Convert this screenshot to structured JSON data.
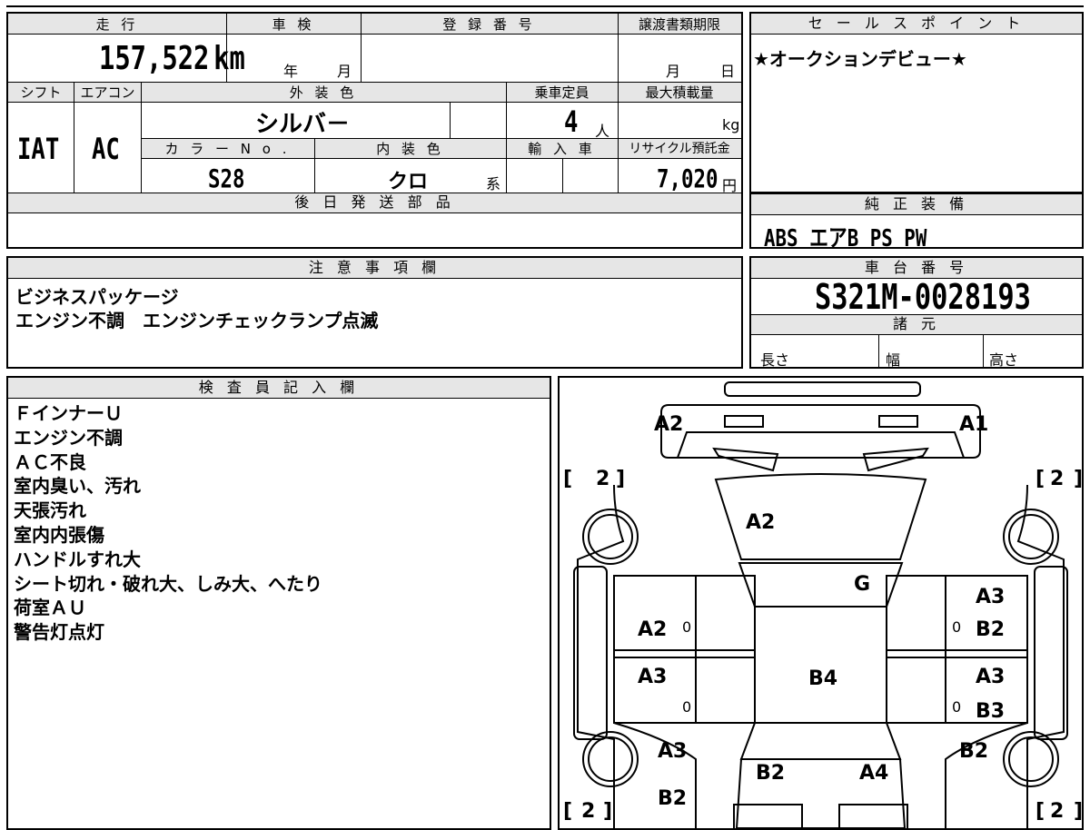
{
  "spec": {
    "headers": {
      "mileage": "走 行",
      "inspection": "車 検",
      "registration": "登 録 番 号",
      "transfer_deadline": "譲渡書類期限",
      "shift": "シフト",
      "aircon": "エアコン",
      "exterior_color": "外 装 色",
      "capacity": "乗車定員",
      "max_load": "最大積載量",
      "color_no": "カ ラ ー N o .",
      "interior_color": "内 装 色",
      "import": "輸 入 車",
      "recycle": "リサイクル預託金",
      "later_parts": "後 日 発 送 部 品"
    },
    "mileage_value": "157,522",
    "mileage_unit": "km",
    "year_label": "年",
    "month_label": "月",
    "day_label": "日",
    "shift_value": "IAT",
    "aircon_value": "AC",
    "exterior_color_value": "シルバ－",
    "capacity_value": "4",
    "capacity_unit": "人",
    "max_load_unit": "kg",
    "color_no_value": "S28",
    "interior_color_value": "クロ",
    "interior_suffix": "系",
    "recycle_value": "7,020",
    "recycle_unit": "円"
  },
  "sales_points": {
    "header": "セ ー ル ス ポ イ ン ト",
    "text": "★オークションデビュー★"
  },
  "equipment": {
    "header": "純 正 装 備",
    "text": "ABS エアB PS PW"
  },
  "notes": {
    "header": "注 意 事 項 欄",
    "lines": [
      "ビジネスパッケージ",
      "エンジン不調　エンジンチェックランプ点滅"
    ]
  },
  "chassis": {
    "header": "車 台 番 号",
    "value": "S321M-0028193",
    "specs_header": "諸 元",
    "length_label": "長さ",
    "width_label": "幅",
    "height_label": "高さ"
  },
  "inspector": {
    "header": "検 査 員 記 入 欄",
    "lines": [
      "ＦインナーＵ",
      "エンジン不調",
      "ＡＣ不良",
      "室内臭い、汚れ",
      "天張汚れ",
      "室内内張傷",
      "ハンドルすれ大",
      "シート切れ・破れ大、しみ大、へたり",
      "荷室ＡＵ",
      "警告灯点灯"
    ]
  },
  "diagram": {
    "marks": {
      "front_left": "A2",
      "front_right": "A1",
      "hood": "A2",
      "windshield": "G",
      "left_front_door": "A2",
      "right_front_door_1": "A3",
      "right_front_door_2": "B2",
      "left_rear_door": "A3",
      "right_rear_door_1": "A3",
      "right_rear_door_2": "B3",
      "roof": "B4",
      "left_quarter": "A3",
      "right_quarter": "B2",
      "rear_left_bumper": "B2",
      "rear_center_left": "B2",
      "rear_center_right": "A4"
    },
    "tire_depth": "2",
    "door_zero": "0"
  }
}
